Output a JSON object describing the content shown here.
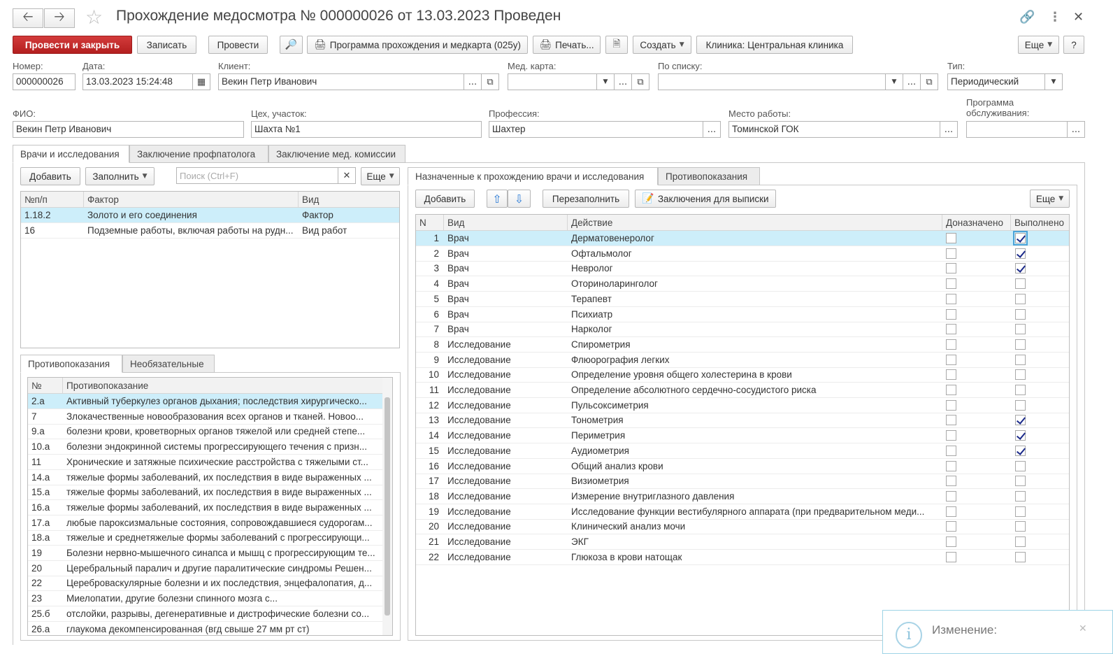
{
  "window": {
    "title": "Прохождение медосмотра № 000000026 от 13.03.2023 Проведен"
  },
  "toolbar": {
    "post_close": "Провести и закрыть",
    "save": "Записать",
    "post": "Провести",
    "program": "Программа прохождения и медкарта (025у)",
    "print": "Печать...",
    "create": "Создать",
    "clinic": "Клиника: Центральная клиника",
    "more": "Еще",
    "help": "?"
  },
  "header": {
    "number_label": "Номер:",
    "number": "000000026",
    "date_label": "Дата:",
    "date": "13.03.2023 15:24:48",
    "client_label": "Клиент:",
    "client": "Векин Петр Иванович",
    "medcard_label": "Мед. карта:",
    "medcard": "",
    "bylist_label": "По списку:",
    "bylist": "",
    "type_label": "Тип:",
    "type": "Периодический",
    "fio_label": "ФИО:",
    "fio": "Векин Петр Иванович",
    "shop_label": "Цех, участок:",
    "shop": "Шахта №1",
    "profession_label": "Профессия:",
    "profession": "Шахтер",
    "workplace_label": "Место работы:",
    "workplace": "Томинской ГОК",
    "program_label_1": "Программа",
    "program_label_2": "обслуживания:",
    "program": ""
  },
  "main_tabs": [
    "Врачи и исследования",
    "Заключение профпатолога",
    "Заключение мед. комиссии"
  ],
  "left": {
    "add": "Добавить",
    "fill": "Заполнить",
    "search_placeholder": "Поиск (Ctrl+F)",
    "more": "Еще",
    "factors_cols": [
      "№п/п",
      "Фактор",
      "Вид"
    ],
    "factors": [
      {
        "n": "1.18.2",
        "factor": "Золото и его соединения",
        "kind": "Фактор"
      },
      {
        "n": "16",
        "factor": "Подземные работы, включая работы на рудн...",
        "kind": "Вид работ"
      }
    ],
    "sub_tabs": [
      "Противопоказания",
      "Необязательные"
    ],
    "contra_cols": [
      "№",
      "Противопоказание"
    ],
    "contra": [
      {
        "n": "2.а",
        "t": "Активный туберкулез органов дыхания; последствия хирургическо..."
      },
      {
        "n": "7",
        "t": "Злокачественные новообразования всех органов и тканей. Новоо..."
      },
      {
        "n": "9.а",
        "t": "болезни крови, кроветворных органов тяжелой или средней степе..."
      },
      {
        "n": "10.а",
        "t": "болезни эндокринной системы прогрессирующего течения с призн..."
      },
      {
        "n": "11",
        "t": "Хронические и затяжные психические расстройства с тяжелыми ст..."
      },
      {
        "n": "14.а",
        "t": "тяжелые формы заболеваний, их последствия в виде выраженных ..."
      },
      {
        "n": "15.а",
        "t": "тяжелые формы заболеваний, их последствия в виде выраженных ..."
      },
      {
        "n": "16.а",
        "t": "тяжелые формы заболеваний, их последствия в виде выраженных ..."
      },
      {
        "n": "17.а",
        "t": "любые пароксизмальные состояния, сопровождавшиеся судорогам..."
      },
      {
        "n": "18.а",
        "t": "тяжелые и среднетяжелые формы заболеваний с прогрессирующи..."
      },
      {
        "n": "19",
        "t": "Болезни нервно-мышечного синапса и мышц с прогрессирующим те..."
      },
      {
        "n": "20",
        "t": "Церебральный паралич и другие паралитические синдромы Решен..."
      },
      {
        "n": "22",
        "t": "Цереброваскулярные болезни и их последствия, энцефалопатия, д..."
      },
      {
        "n": "23",
        "t": "Миелопатии, другие болезни спинного мозга с..."
      },
      {
        "n": "25.б",
        "t": "отслойки, разрывы, дегенеративные и дистрофические болезни со..."
      },
      {
        "n": "26.а",
        "t": "глаукома декомпенсированная (вгд свыше 27 мм рт ст)"
      }
    ]
  },
  "right": {
    "tabs": [
      "Назначенные к прохождению врачи и исследования",
      "Противопоказания"
    ],
    "add": "Добавить",
    "refill": "Перезаполнить",
    "conclusions": "Заключения для выписки",
    "more": "Еще",
    "cols": [
      "N",
      "Вид",
      "Действие",
      "Доназначено",
      "Выполнено"
    ],
    "rows": [
      {
        "n": "1",
        "kind": "Врач",
        "action": "Дерматовенеролог",
        "extra": false,
        "done": true
      },
      {
        "n": "2",
        "kind": "Врач",
        "action": "Офтальмолог",
        "extra": false,
        "done": true
      },
      {
        "n": "3",
        "kind": "Врач",
        "action": "Невролог",
        "extra": false,
        "done": true
      },
      {
        "n": "4",
        "kind": "Врач",
        "action": "Оториноларинголог",
        "extra": false,
        "done": false
      },
      {
        "n": "5",
        "kind": "Врач",
        "action": "Терапевт",
        "extra": false,
        "done": false
      },
      {
        "n": "6",
        "kind": "Врач",
        "action": "Психиатр",
        "extra": false,
        "done": false
      },
      {
        "n": "7",
        "kind": "Врач",
        "action": "Нарколог",
        "extra": false,
        "done": false
      },
      {
        "n": "8",
        "kind": "Исследование",
        "action": "Спирометрия",
        "extra": false,
        "done": false
      },
      {
        "n": "9",
        "kind": "Исследование",
        "action": "Флюорография легких",
        "extra": false,
        "done": false
      },
      {
        "n": "10",
        "kind": "Исследование",
        "action": "Определение уровня общего холестерина в крови",
        "extra": false,
        "done": false
      },
      {
        "n": "11",
        "kind": "Исследование",
        "action": "Определение абсолютного сердечно-сосудистого риска",
        "extra": false,
        "done": false
      },
      {
        "n": "12",
        "kind": "Исследование",
        "action": "Пульсоксиметрия",
        "extra": false,
        "done": false
      },
      {
        "n": "13",
        "kind": "Исследование",
        "action": "Тонометрия",
        "extra": false,
        "done": true
      },
      {
        "n": "14",
        "kind": "Исследование",
        "action": "Периметрия",
        "extra": false,
        "done": true
      },
      {
        "n": "15",
        "kind": "Исследование",
        "action": "Аудиометрия",
        "extra": false,
        "done": true
      },
      {
        "n": "16",
        "kind": "Исследование",
        "action": "Общий анализ крови",
        "extra": false,
        "done": false
      },
      {
        "n": "17",
        "kind": "Исследование",
        "action": "Визиометрия",
        "extra": false,
        "done": false
      },
      {
        "n": "18",
        "kind": "Исследование",
        "action": "Измерение внутриглазного давления",
        "extra": false,
        "done": false
      },
      {
        "n": "19",
        "kind": "Исследование",
        "action": "Исследование функции вестибулярного аппарата (при предварительном меди...",
        "extra": false,
        "done": false
      },
      {
        "n": "20",
        "kind": "Исследование",
        "action": "Клинический анализ мочи",
        "extra": false,
        "done": false
      },
      {
        "n": "21",
        "kind": "Исследование",
        "action": "ЭКГ",
        "extra": false,
        "done": false
      },
      {
        "n": "22",
        "kind": "Исследование",
        "action": "Глюкоза в крови натощак",
        "extra": false,
        "done": false
      }
    ]
  },
  "notification": {
    "title": "Изменение:"
  }
}
